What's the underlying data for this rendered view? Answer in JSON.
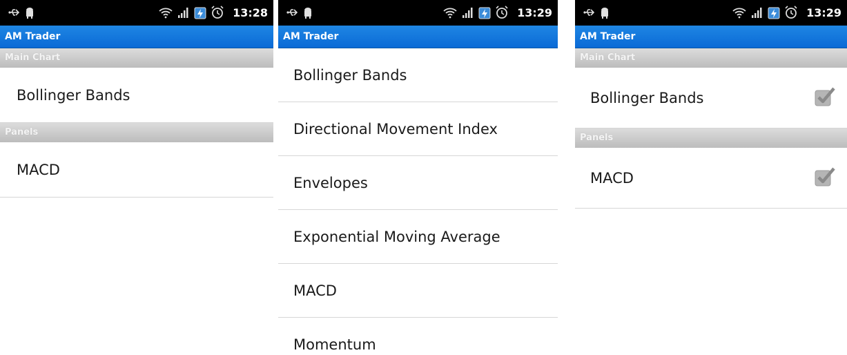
{
  "screens": [
    {
      "status": {
        "time": "13:28"
      },
      "app_title": "AM Trader",
      "sections": [
        {
          "header": "Main Chart",
          "items": [
            {
              "label": "Bollinger Bands"
            }
          ]
        },
        {
          "header": "Panels",
          "items": [
            {
              "label": "MACD"
            }
          ]
        }
      ]
    },
    {
      "status": {
        "time": "13:29"
      },
      "app_title": "AM Trader",
      "items": [
        {
          "label": "Bollinger Bands"
        },
        {
          "label": "Directional Movement Index"
        },
        {
          "label": "Envelopes"
        },
        {
          "label": "Exponential Moving Average"
        },
        {
          "label": "MACD"
        },
        {
          "label": "Momentum"
        }
      ]
    },
    {
      "status": {
        "time": "13:29"
      },
      "app_title": "AM Trader",
      "sections": [
        {
          "header": "Main Chart",
          "items": [
            {
              "label": "Bollinger Bands",
              "checked": true
            }
          ]
        },
        {
          "header": "Panels",
          "items": [
            {
              "label": "MACD",
              "checked": true
            }
          ]
        }
      ]
    }
  ],
  "colors": {
    "status_bar": "#000000",
    "title_bar": "#1677dd",
    "section_header": "#c8c8c8",
    "checkbox": "#8e8e8e"
  },
  "icons": [
    "usb-icon",
    "android-icon",
    "wifi-icon",
    "signal-icon",
    "battery-charging-icon",
    "alarm-icon",
    "checkbox-checked-icon"
  ]
}
